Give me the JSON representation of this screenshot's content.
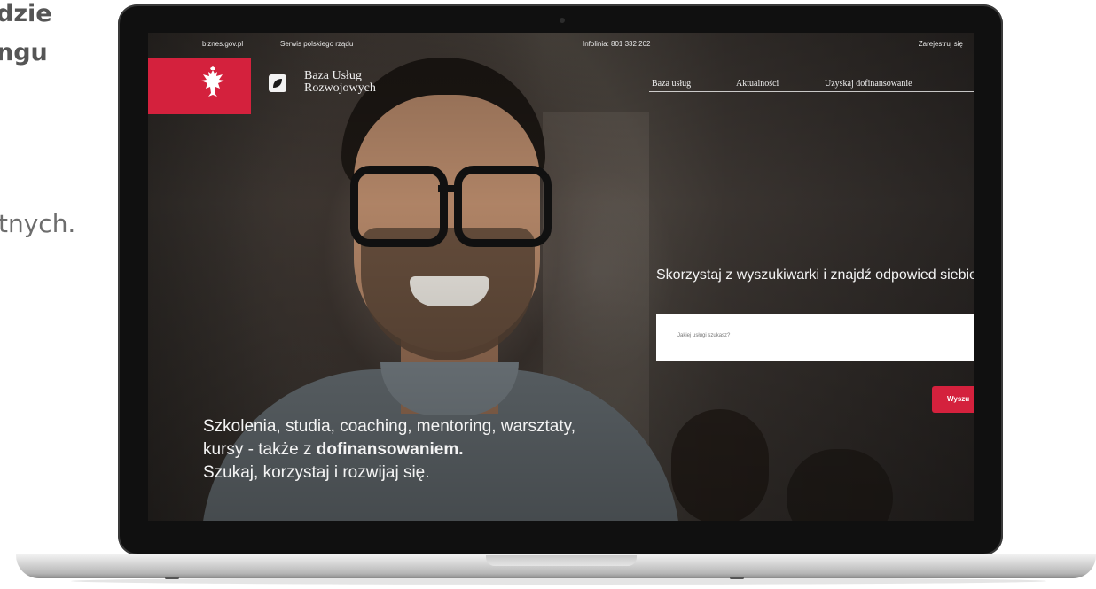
{
  "page_side": {
    "heading_lines": [
      "dzie",
      "ngu"
    ],
    "text_fragment": "tnych."
  },
  "top_bar": {
    "link_biznes": "biznes.gov.pl",
    "link_serwis": "Serwis polskiego rządu",
    "infolinia": "Infolinia: 801 332 202",
    "login": "Zarejestruj się"
  },
  "brand": {
    "name_line1": "Baza Usług",
    "name_line2": "Rozwojowych"
  },
  "nav": {
    "item1": "Baza usług",
    "item2": "Aktualności",
    "item3": "Uzyskaj dofinansowanie"
  },
  "search": {
    "prompt": "Skorzystaj z wyszukiwarki i znajdź odpowied siebie",
    "placeholder": "Jakiej usługi szukasz?",
    "button_label": "Wyszu"
  },
  "hero": {
    "line1": "Szkolenia, studia, coaching, mentoring, warsztaty,",
    "line2_prefix": "kursy - także z ",
    "line2_bold": "dofinansowaniem.",
    "line3": "Szukaj, korzystaj i rozwijaj się."
  },
  "colors": {
    "accent_red": "#d4213d",
    "screen_text": "#f4f4f4"
  },
  "icons": [
    "polish-eagle-emblem-icon",
    "leaf-logo-icon",
    "camera-icon"
  ]
}
